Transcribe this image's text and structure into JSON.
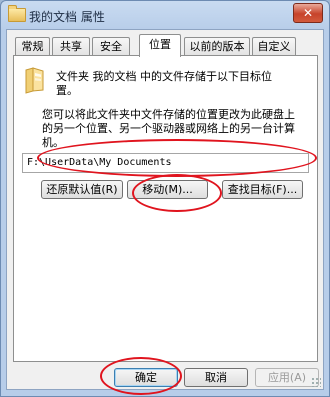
{
  "window": {
    "title": "我的文档 属性",
    "close_symbol": "✕"
  },
  "tabs": [
    {
      "label": "常规"
    },
    {
      "label": "共享"
    },
    {
      "label": "安全"
    },
    {
      "label": "位置",
      "active": true
    },
    {
      "label": "以前的版本"
    },
    {
      "label": "自定义"
    }
  ],
  "location": {
    "header_line1": "文件夹 我的文档 中的文件存储于以下目标位",
    "header_line2": "置。",
    "desc_line1": "您可以将此文件夹中文件存储的位置更改为此硬盘上",
    "desc_line2": "的另一个位置、另一个驱动器或网络上的另一台计算",
    "desc_line3": "机。",
    "path_value": "F:\\UserData\\My Documents",
    "restore_default_label": "还原默认值(R)",
    "move_label": "移动(M)...",
    "find_target_label": "查找目标(F)..."
  },
  "footer": {
    "ok_label": "确定",
    "cancel_label": "取消",
    "apply_label": "应用(A)"
  },
  "icons": [
    "folder-icon",
    "close-icon"
  ],
  "colors": {
    "annotation": "#e0141e",
    "title_bar": "#b7cde9"
  }
}
